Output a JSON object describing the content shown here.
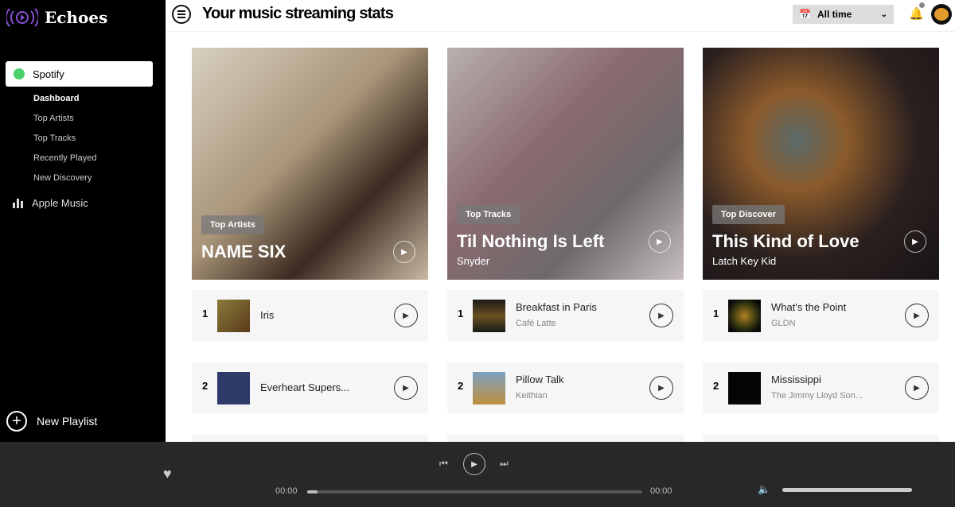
{
  "app": {
    "name": "Echoes",
    "accent": "#7b3fe4"
  },
  "sidebar": {
    "provider_active": "Spotify",
    "items": [
      "Dashboard",
      "Top Artists",
      "Top Tracks",
      "Recently Played",
      "New Discovery"
    ],
    "provider_other": "Apple Music",
    "new_playlist": "New Playlist"
  },
  "header": {
    "title": "Your music streaming stats",
    "range": "All time"
  },
  "cards": [
    {
      "badge": "Top Artists",
      "title": "NAME SIX",
      "subtitle": ""
    },
    {
      "badge": "Top Tracks",
      "title": "Til Nothing Is Left",
      "subtitle": "Snyder"
    },
    {
      "badge": "Top Discover",
      "title": "This Kind of Love",
      "subtitle": "Latch Key Kid"
    }
  ],
  "lists": [
    [
      {
        "rank": "1",
        "name": "Iris",
        "artist": ""
      },
      {
        "rank": "2",
        "name": "Everheart Supers...",
        "artist": ""
      }
    ],
    [
      {
        "rank": "1",
        "name": "Breakfast in Paris",
        "artist": "Café Latte"
      },
      {
        "rank": "2",
        "name": "Pillow Talk",
        "artist": "Keithian"
      }
    ],
    [
      {
        "rank": "1",
        "name": "What's the Point",
        "artist": "GLDN"
      },
      {
        "rank": "2",
        "name": "Mississippi",
        "artist": "The Jimmy Lloyd Son..."
      }
    ]
  ],
  "player": {
    "elapsed": "00:00",
    "duration": "00:00",
    "progress": 0.03,
    "volume": 1.0
  }
}
